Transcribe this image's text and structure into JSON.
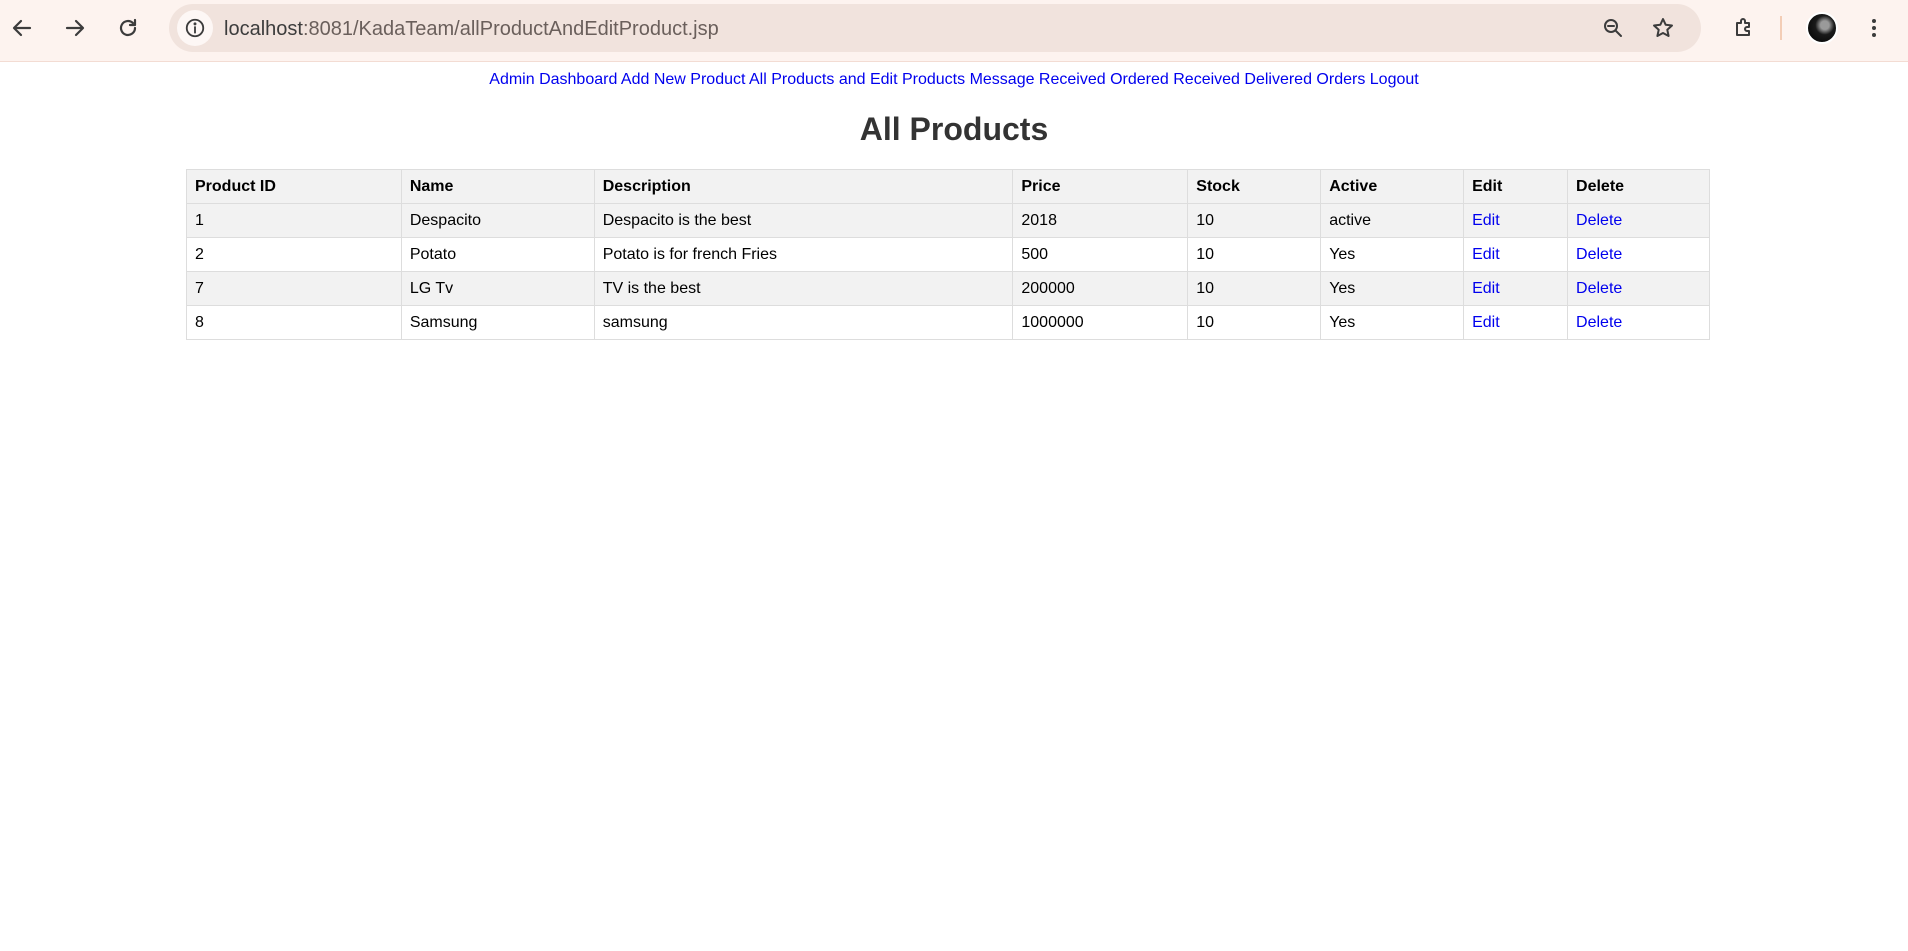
{
  "browser": {
    "url_host": "localhost",
    "url_path": ":8081/KadaTeam/allProductAndEditProduct.jsp"
  },
  "nav": {
    "links": [
      {
        "label": "Admin Dashboard"
      },
      {
        "label": "Add New Product"
      },
      {
        "label": "All Products and Edit Products"
      },
      {
        "label": "Message Received"
      },
      {
        "label": "Ordered Received"
      },
      {
        "label": "Delivered Orders"
      },
      {
        "label": "Logout"
      }
    ]
  },
  "page": {
    "title": "All Products"
  },
  "table": {
    "headers": [
      "Product ID",
      "Name",
      "Description",
      "Price",
      "Stock",
      "Active",
      "Edit",
      "Delete"
    ],
    "rows": [
      {
        "id": "1",
        "name": "Despacito",
        "description": "Despacito is the best",
        "price": "2018",
        "stock": "10",
        "active": "active",
        "edit": "Edit",
        "delete": "Delete"
      },
      {
        "id": "2",
        "name": "Potato",
        "description": "Potato is for french Fries",
        "price": "500",
        "stock": "10",
        "active": "Yes",
        "edit": "Edit",
        "delete": "Delete"
      },
      {
        "id": "7",
        "name": "LG Tv",
        "description": "TV is the best",
        "price": "200000",
        "stock": "10",
        "active": "Yes",
        "edit": "Edit",
        "delete": "Delete"
      },
      {
        "id": "8",
        "name": "Samsung",
        "description": "samsung",
        "price": "1000000",
        "stock": "10",
        "active": "Yes",
        "edit": "Edit",
        "delete": "Delete"
      }
    ]
  },
  "colors": {
    "link": "#0000ee",
    "header_bg": "#f2f2f2",
    "border": "#dddddd",
    "chrome_bg": "#fdf3ef"
  }
}
